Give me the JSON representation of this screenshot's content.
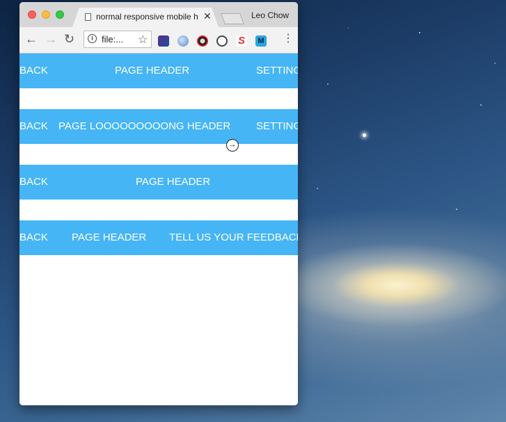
{
  "browser": {
    "tab_title": "normal responsive mobile h",
    "tab_close": "✕",
    "profile_name": "Leo Chow",
    "url": "file:...",
    "nav": {
      "back": "←",
      "forward": "→",
      "reload": "↻"
    },
    "menu": "⋮",
    "extensions": [
      "ext-icon-1",
      "globe-icon",
      "chrome-color-icon",
      "sync-icon",
      "s-icon",
      "m-icon"
    ],
    "ext5_label": "S",
    "ext6_label": "M"
  },
  "headers": [
    {
      "left": "BACK",
      "center": "PAGE HEADER",
      "right": "SETTING"
    },
    {
      "left": "BACK",
      "center": "PAGE LOOOOOOOOONG HEADER",
      "right": "SETTING"
    },
    {
      "left": "BACK",
      "center": "PAGE HEADER",
      "right": ""
    },
    {
      "left": "BACK",
      "center": "PAGE HEADER",
      "right": "TELL US YOUR FEEDBACK"
    }
  ],
  "colors": {
    "header_bg": "#45b5f5",
    "header_text": "#ffffff"
  }
}
